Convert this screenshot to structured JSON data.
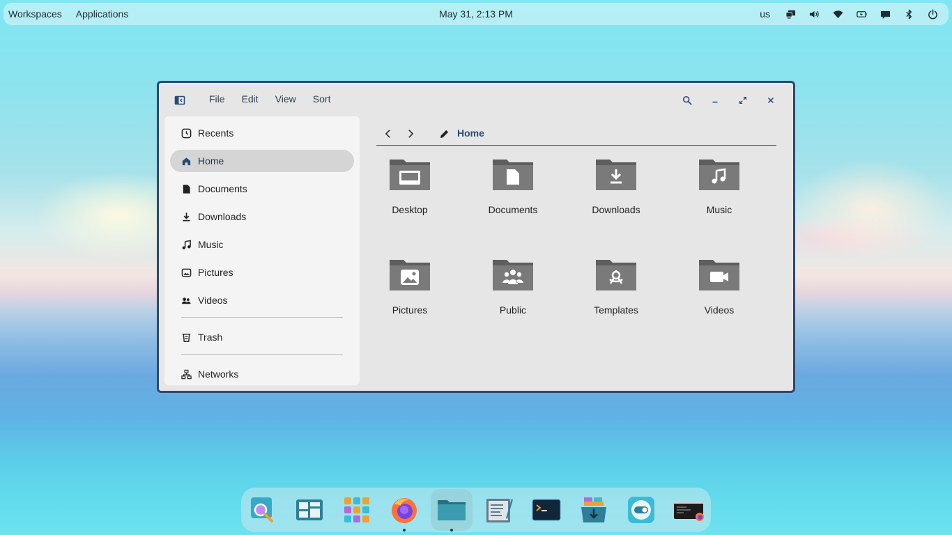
{
  "topbar": {
    "workspaces": "Workspaces",
    "applications": "Applications",
    "clock": "May 31, 2:13 PM",
    "keyboard_layout": "us",
    "tray_icons": [
      "display-icon",
      "volume-icon",
      "wifi-icon",
      "battery-icon",
      "chat-icon",
      "bluetooth-icon",
      "power-icon"
    ]
  },
  "window": {
    "menu": [
      "File",
      "Edit",
      "View",
      "Sort"
    ],
    "sidebar": {
      "items": [
        {
          "label": "Recents",
          "icon": "clock-icon"
        },
        {
          "label": "Home",
          "icon": "home-icon",
          "active": true
        },
        {
          "label": "Documents",
          "icon": "document-icon"
        },
        {
          "label": "Downloads",
          "icon": "download-icon"
        },
        {
          "label": "Music",
          "icon": "music-icon"
        },
        {
          "label": "Pictures",
          "icon": "picture-icon"
        },
        {
          "label": "Videos",
          "icon": "video-icon"
        }
      ],
      "trash": {
        "label": "Trash",
        "icon": "trash-icon"
      },
      "networks": {
        "label": "Networks",
        "icon": "network-icon"
      }
    },
    "path": {
      "current": "Home"
    },
    "folders": [
      {
        "label": "Desktop",
        "icon": "desktop-folder-icon"
      },
      {
        "label": "Documents",
        "icon": "documents-folder-icon"
      },
      {
        "label": "Downloads",
        "icon": "downloads-folder-icon"
      },
      {
        "label": "Music",
        "icon": "music-folder-icon"
      },
      {
        "label": "Pictures",
        "icon": "pictures-folder-icon"
      },
      {
        "label": "Public",
        "icon": "public-folder-icon"
      },
      {
        "label": "Templates",
        "icon": "templates-folder-icon"
      },
      {
        "label": "Videos",
        "icon": "videos-folder-icon"
      }
    ],
    "colors": {
      "accent": "#2b4a73",
      "folder": "#6e6e6e",
      "window_bg": "#e6e6e6",
      "sidebar_bg": "#f4f4f4"
    }
  },
  "dock": {
    "apps": [
      {
        "name": "search-app-icon"
      },
      {
        "name": "workspaces-app-icon"
      },
      {
        "name": "app-grid-icon"
      },
      {
        "name": "firefox-icon",
        "running": true
      },
      {
        "name": "files-icon",
        "running": true,
        "active": true
      },
      {
        "name": "text-editor-icon"
      },
      {
        "name": "terminal-icon"
      },
      {
        "name": "software-installer-icon"
      },
      {
        "name": "settings-toggle-icon"
      },
      {
        "name": "system-monitor-icon"
      }
    ]
  }
}
